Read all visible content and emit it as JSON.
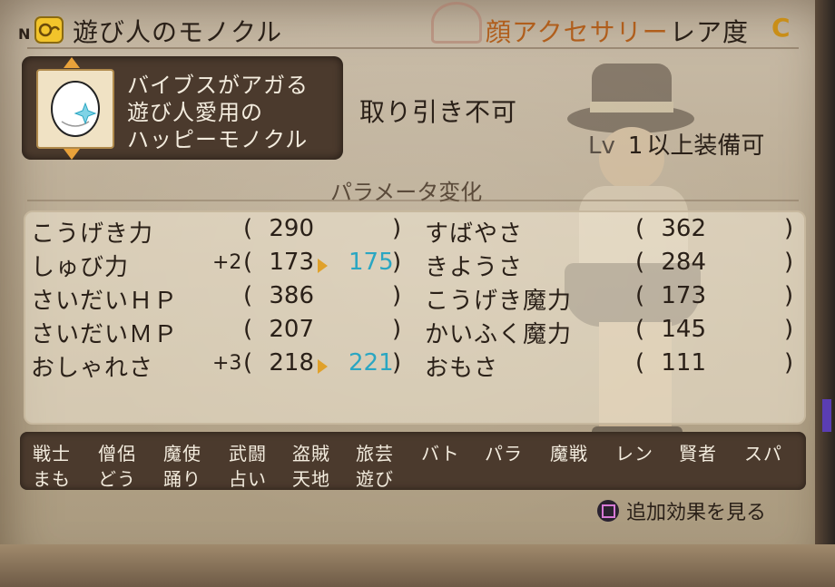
{
  "header": {
    "new_mark": "N",
    "item_name": "遊び人のモノクル",
    "category": "顔アクセサリー",
    "rarity_label": "レア度",
    "rarity_grade": "C"
  },
  "description": [
    "バイブスがアガる",
    "遊び人愛用の",
    "ハッピーモノクル"
  ],
  "trade_status": "取り引き不可",
  "level": {
    "label": "Lv",
    "value": "1",
    "suffix": "以上装備可"
  },
  "param_title": "パラメータ変化",
  "stats_left": [
    {
      "name": "こうげき力",
      "bonus": "",
      "value": "290",
      "new": ""
    },
    {
      "name": "しゅび力",
      "bonus": "+2",
      "value": "173",
      "new": "175"
    },
    {
      "name": "さいだいＨＰ",
      "bonus": "",
      "value": "386",
      "new": ""
    },
    {
      "name": "さいだいＭＰ",
      "bonus": "",
      "value": "207",
      "new": ""
    },
    {
      "name": "おしゃれさ",
      "bonus": "+3",
      "value": "218",
      "new": "221"
    }
  ],
  "stats_right": [
    {
      "name": "すばやさ",
      "value": "362"
    },
    {
      "name": "きようさ",
      "value": "284"
    },
    {
      "name": "こうげき魔力",
      "value": "173"
    },
    {
      "name": "かいふく魔力",
      "value": "145"
    },
    {
      "name": "おもさ",
      "value": "111"
    }
  ],
  "paren_open": "(",
  "paren_close": ")",
  "jobs_row1": [
    "戦士",
    "僧侶",
    "魔使",
    "武闘",
    "盗賊",
    "旅芸",
    "バト",
    "パラ",
    "魔戦",
    "レン",
    "賢者",
    "スパ"
  ],
  "jobs_row2": [
    "まも",
    "どう",
    "踊り",
    "占い",
    "天地",
    "遊び"
  ],
  "footer": {
    "more_effects": "追加効果を見る"
  },
  "colors": {
    "category": "#b05e1c",
    "rarity": "#c98e18",
    "increased_value": "#2aa6c2",
    "arrow": "#e0a12a",
    "panel_dark": "#4b3a2d"
  }
}
